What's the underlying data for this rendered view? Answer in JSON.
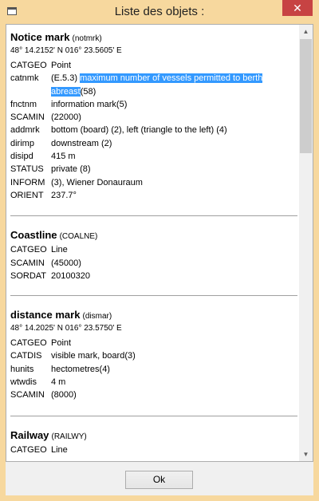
{
  "window": {
    "title": "Liste des objets :",
    "close_glyph": "✕"
  },
  "objects": [
    {
      "name": "Notice mark",
      "code": "(notmrk)",
      "coords": "48° 14.2152' N 016° 23.5605' E",
      "attrs": [
        {
          "k": "CATGEO",
          "v": "Point"
        },
        {
          "k": "catnmk",
          "v_pre": "(E.5.3) ",
          "v_hl": "maximum number of vessels permitted to berth abreast",
          "v_post": "(58)"
        },
        {
          "k": "fnctnm",
          "v": "information mark(5)"
        },
        {
          "k": "SCAMIN",
          "v": "(22000)"
        },
        {
          "k": "addmrk",
          "v": "bottom (board) (2), left (triangle to the left) (4)"
        },
        {
          "k": "dirimp",
          "v": "downstream (2)"
        },
        {
          "k": "disipd",
          "v": "415 m"
        },
        {
          "k": "STATUS",
          "v": "private (8)"
        },
        {
          "k": "INFORM",
          "v": "(3), Wiener Donauraum"
        },
        {
          "k": "ORIENT",
          "v": "237.7°"
        }
      ]
    },
    {
      "name": "Coastline",
      "code": "(COALNE)",
      "coords": "",
      "attrs": [
        {
          "k": "CATGEO",
          "v": "Line"
        },
        {
          "k": "SCAMIN",
          "v": "(45000)"
        },
        {
          "k": "SORDAT",
          "v": "20100320"
        }
      ]
    },
    {
      "name": "distance mark",
      "code": "(dismar)",
      "coords": "48° 14.2025' N 016° 23.5750' E",
      "attrs": [
        {
          "k": "CATGEO",
          "v": "Point"
        },
        {
          "k": "CATDIS",
          "v": "visible mark, board(3)"
        },
        {
          "k": "hunits",
          "v": "hectometres(4)"
        },
        {
          "k": "wtwdis",
          "v": "4 m"
        },
        {
          "k": "SCAMIN",
          "v": "(8000)"
        }
      ]
    },
    {
      "name": "Railway",
      "code": "(RAILWY)",
      "coords": "",
      "attrs": [
        {
          "k": "CATGEO",
          "v": "Line"
        }
      ]
    }
  ],
  "buttons": {
    "ok": "Ok"
  },
  "scrollbar": {
    "up_glyph": "▲",
    "down_glyph": "▼"
  },
  "colors": {
    "frame": "#f7d89e",
    "close": "#c74343",
    "selection": "#3399ff"
  }
}
